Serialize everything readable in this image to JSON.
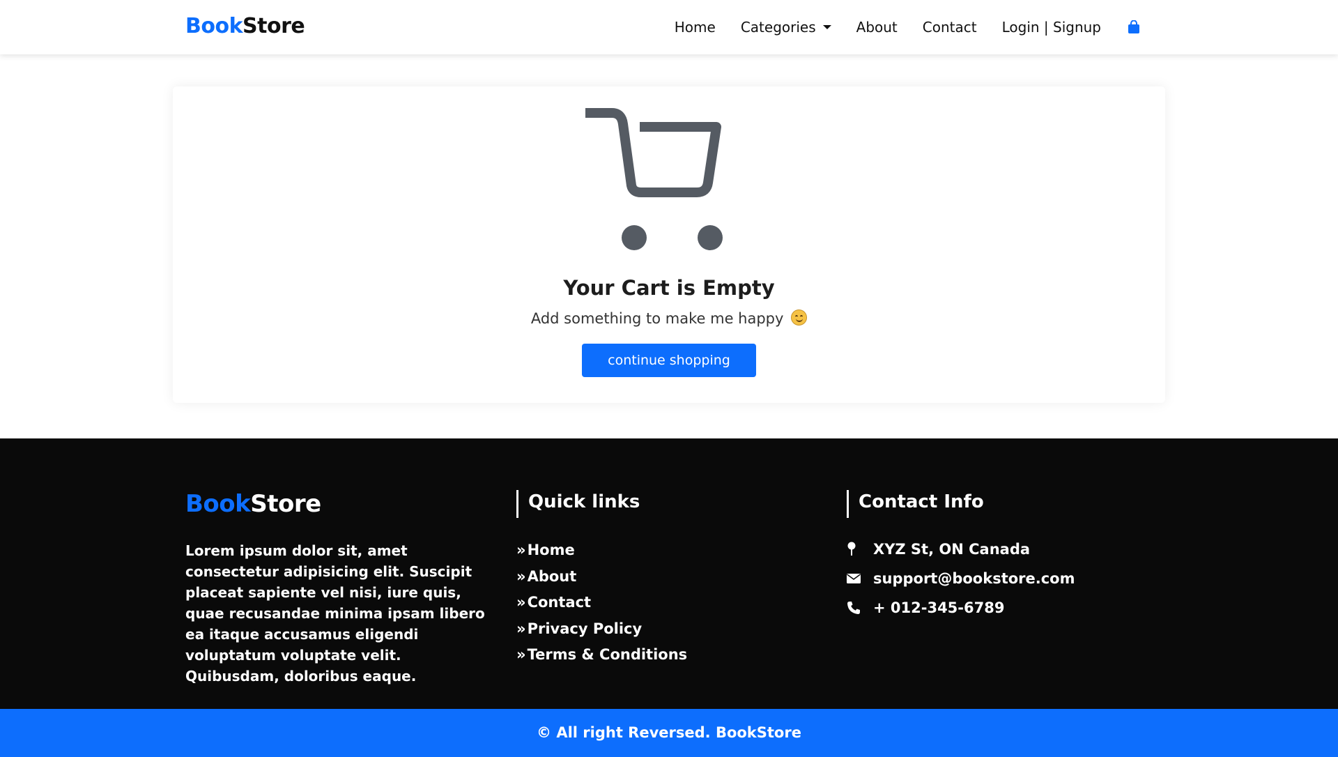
{
  "navbar": {
    "brand_part1": "Book",
    "brand_part2": "Store",
    "links": {
      "home": "Home",
      "categories": "Categories",
      "about": "About",
      "contact": "Contact",
      "login": "Login | Signup"
    },
    "cart_icon": "shopping-bag-icon"
  },
  "empty_cart": {
    "icon": "cart-icon",
    "title": "Your Cart is Empty",
    "subtitle": "Add something to make me happy",
    "emoji": "smiling-face-emoji",
    "button": "continue shopping"
  },
  "footer": {
    "brand_part1": "Book",
    "brand_part2": "Store",
    "about": "Lorem ipsum dolor sit, amet consectetur adipisicing elit. Suscipit placeat sapiente vel nisi, iure quis, quae recusandae minima ipsam libero ea itaque accusamus eligendi voluptatum voluptate velit. Quibusdam, doloribus eaque.",
    "quick_links_title": "Quick links",
    "quick_links": [
      "Home",
      "About",
      "Contact",
      "Privacy Policy",
      "Terms & Conditions"
    ],
    "contact_title": "Contact Info",
    "contact": {
      "address": "XYZ St, ON Canada",
      "email": "support@bookstore.com",
      "phone": "+ 012-345-6789"
    },
    "copyright": "© All right Reversed.  BookStore"
  },
  "colors": {
    "accent": "#0d6efd",
    "footer_bg": "#0a0a0a",
    "cart_icon": "#555b63"
  }
}
